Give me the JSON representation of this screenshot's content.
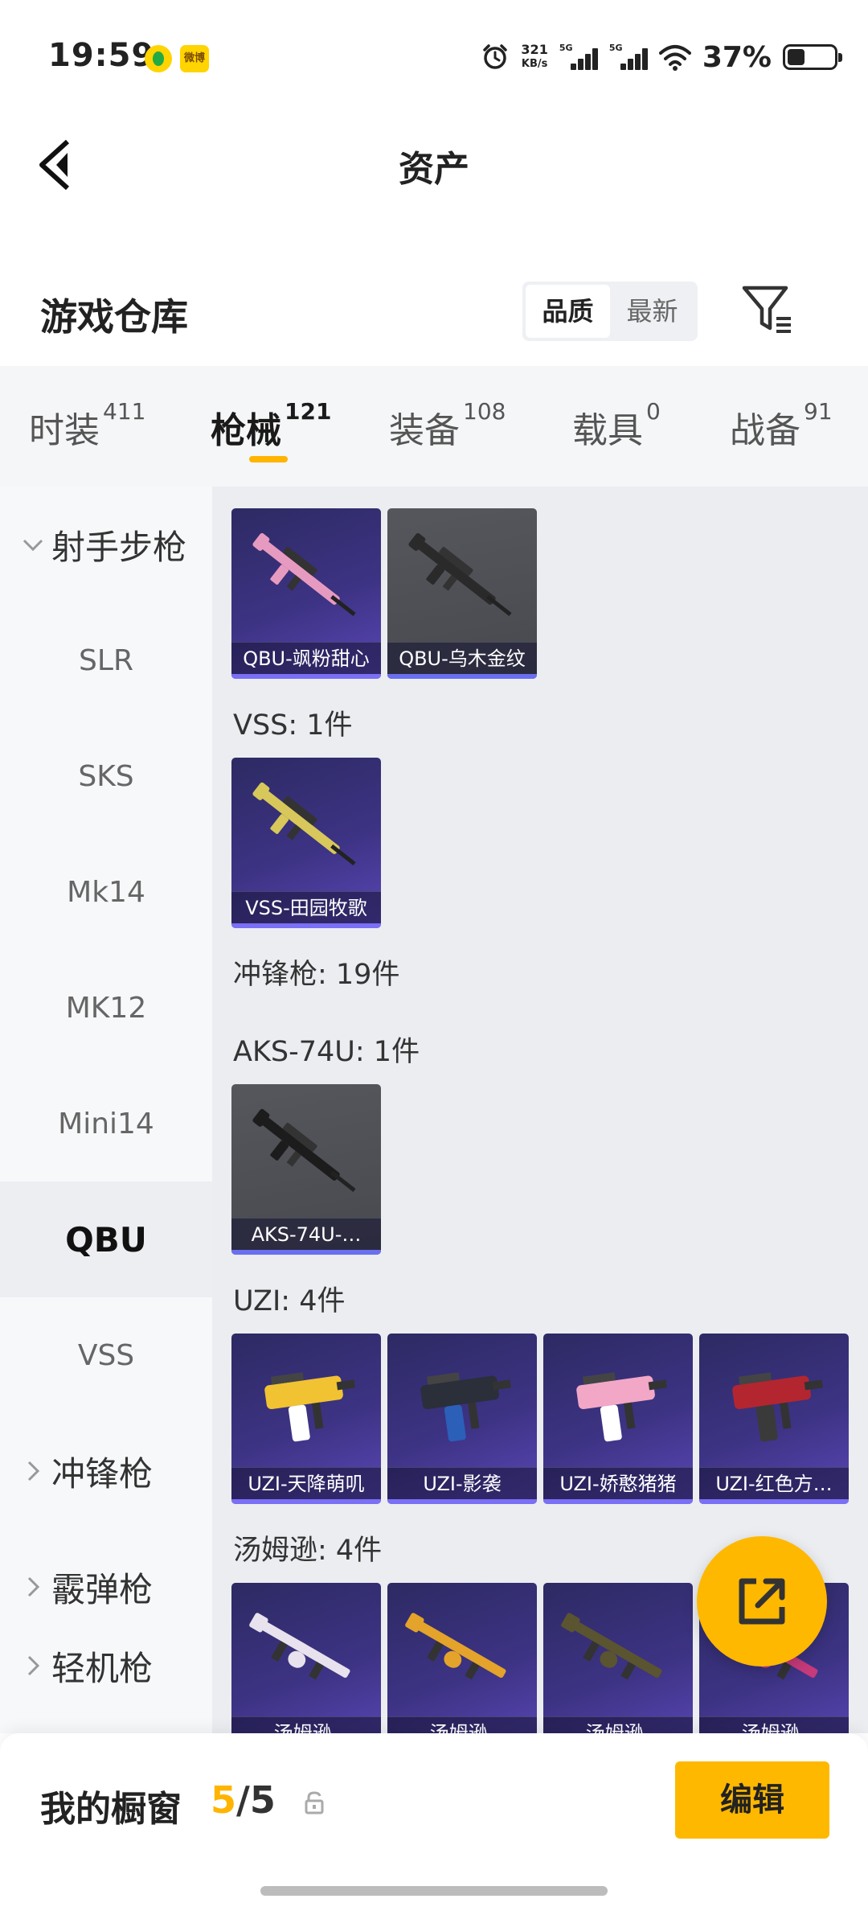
{
  "status_bar": {
    "time": "19:59",
    "app_badge": "微博",
    "speed_value": "321",
    "speed_unit": "KB/s",
    "signal1_label": "5G",
    "signal2_label": "5G",
    "battery_text": "37%",
    "battery_level": 0.37
  },
  "header": {
    "title": "资产",
    "back_icon": "chevron-left-icon"
  },
  "warehouse": {
    "title": "游戏仓库",
    "sort_options": [
      "品质",
      "最新"
    ],
    "sort_selected": "品质",
    "filter_icon": "filter-icon"
  },
  "tabs": [
    {
      "label": "时装",
      "count": "411"
    },
    {
      "label": "枪械",
      "count": "121",
      "active": true
    },
    {
      "label": "装备",
      "count": "108"
    },
    {
      "label": "载具",
      "count": "0"
    },
    {
      "label": "战备",
      "count": "91"
    }
  ],
  "sidebar": {
    "groups": [
      {
        "label": "射手步枪",
        "expanded": true
      },
      {
        "label": "冲锋枪",
        "expanded": false
      },
      {
        "label": "霰弹枪",
        "expanded": false
      },
      {
        "label": "轻机枪",
        "expanded": false
      }
    ],
    "items": [
      "SLR",
      "SKS",
      "Mk14",
      "MK12",
      "Mini14",
      "QBU",
      "VSS"
    ],
    "active_item": "QBU"
  },
  "content": {
    "qbu_cards": [
      {
        "name": "QBU-飒粉甜心",
        "bg": "purple"
      },
      {
        "name": "QBU-乌木金纹",
        "bg": "gray"
      }
    ],
    "vss_heading": "VSS: 1件",
    "vss_cards": [
      {
        "name": "VSS-田园牧歌",
        "bg": "purple"
      }
    ],
    "smg_heading": "冲锋枪: 19件",
    "aks_heading": "AKS-74U: 1件",
    "aks_cards": [
      {
        "name": "AKS-74U-…",
        "bg": "gray"
      }
    ],
    "uzi_heading": "UZI: 4件",
    "uzi_cards": [
      {
        "name": "UZI-天降萌叽",
        "bg": "purple"
      },
      {
        "name": "UZI-影袭",
        "bg": "purple"
      },
      {
        "name": "UZI-娇憨猪猪",
        "bg": "purple"
      },
      {
        "name": "UZI-红色方…",
        "bg": "purple"
      }
    ],
    "tommy_heading": "汤姆逊: 4件",
    "tommy_cards": [
      {
        "name": "汤姆逊-",
        "bg": "purple"
      },
      {
        "name": "汤姆逊-",
        "bg": "purple"
      },
      {
        "name": "汤姆逊-",
        "bg": "purple"
      },
      {
        "name": "汤姆逊-",
        "bg": "purple"
      }
    ]
  },
  "fab": {
    "icon": "share-external-icon"
  },
  "bottom_bar": {
    "label": "我的橱窗",
    "count_current": "5",
    "count_sep": "/",
    "count_total": "5",
    "edit_label": "编辑",
    "lock_icon": "lock-icon"
  },
  "colors": {
    "accent": "#ffb800",
    "card_purple": "#3d3384",
    "card_gray": "#4f5157",
    "card_edge": "#7a6ff5"
  }
}
